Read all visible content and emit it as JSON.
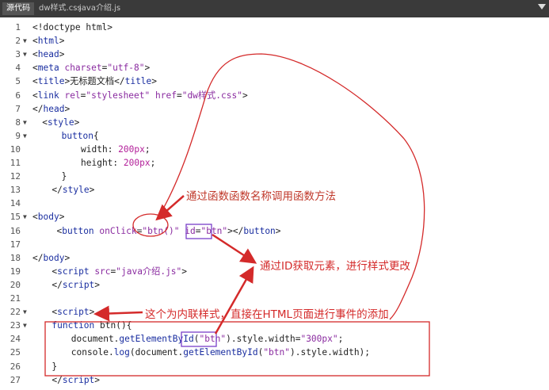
{
  "tabs": [
    {
      "label": "源代码",
      "active": true
    },
    {
      "label": "dw样式.css",
      "active": false
    },
    {
      "label": "java介绍.js",
      "active": false
    }
  ],
  "lines": [
    {
      "num": "1",
      "fold": "",
      "indent": 0,
      "tokens": [
        {
          "t": "p",
          "v": "<!doctype html>"
        }
      ]
    },
    {
      "num": "2",
      "fold": "▼",
      "indent": 0,
      "tokens": [
        {
          "t": "p",
          "v": "<"
        },
        {
          "t": "k",
          "v": "html"
        },
        {
          "t": "p",
          "v": ">"
        }
      ]
    },
    {
      "num": "3",
      "fold": "▼",
      "indent": 0,
      "tokens": [
        {
          "t": "p",
          "v": "<"
        },
        {
          "t": "k",
          "v": "head"
        },
        {
          "t": "p",
          "v": ">"
        }
      ]
    },
    {
      "num": "4",
      "fold": "",
      "indent": 0,
      "tokens": [
        {
          "t": "p",
          "v": "<"
        },
        {
          "t": "k",
          "v": "meta"
        },
        {
          "t": "p",
          "v": " "
        },
        {
          "t": "a",
          "v": "charset"
        },
        {
          "t": "p",
          "v": "="
        },
        {
          "t": "s",
          "v": "\"utf-8\""
        },
        {
          "t": "p",
          "v": ">"
        }
      ]
    },
    {
      "num": "5",
      "fold": "",
      "indent": 0,
      "tokens": [
        {
          "t": "p",
          "v": "<"
        },
        {
          "t": "k",
          "v": "title"
        },
        {
          "t": "p",
          "v": ">无标题文档</"
        },
        {
          "t": "k",
          "v": "title"
        },
        {
          "t": "p",
          "v": ">"
        }
      ]
    },
    {
      "num": "6",
      "fold": "",
      "indent": 0,
      "tokens": [
        {
          "t": "p",
          "v": "<"
        },
        {
          "t": "k",
          "v": "link"
        },
        {
          "t": "p",
          "v": " "
        },
        {
          "t": "a",
          "v": "rel"
        },
        {
          "t": "p",
          "v": "="
        },
        {
          "t": "s",
          "v": "\"stylesheet\""
        },
        {
          "t": "p",
          "v": " "
        },
        {
          "t": "a",
          "v": "href"
        },
        {
          "t": "p",
          "v": "="
        },
        {
          "t": "s",
          "v": "\"dw样式.css\""
        },
        {
          "t": "p",
          "v": ">"
        }
      ]
    },
    {
      "num": "7",
      "fold": "",
      "indent": 0,
      "tokens": [
        {
          "t": "p",
          "v": "</"
        },
        {
          "t": "k",
          "v": "head"
        },
        {
          "t": "p",
          "v": ">"
        }
      ]
    },
    {
      "num": "8",
      "fold": "▼",
      "indent": 2,
      "tokens": [
        {
          "t": "p",
          "v": "<"
        },
        {
          "t": "k",
          "v": "style"
        },
        {
          "t": "p",
          "v": ">"
        }
      ]
    },
    {
      "num": "9",
      "fold": "▼",
      "indent": 6,
      "tokens": [
        {
          "t": "k",
          "v": "button"
        },
        {
          "t": "p",
          "v": "{"
        }
      ]
    },
    {
      "num": "10",
      "fold": "",
      "indent": 10,
      "tokens": [
        {
          "t": "r",
          "v": "width"
        },
        {
          "t": "p",
          "v": ": "
        },
        {
          "t": "n",
          "v": "200px"
        },
        {
          "t": "p",
          "v": ";"
        }
      ]
    },
    {
      "num": "11",
      "fold": "",
      "indent": 10,
      "tokens": [
        {
          "t": "r",
          "v": "height"
        },
        {
          "t": "p",
          "v": ": "
        },
        {
          "t": "n",
          "v": "200px"
        },
        {
          "t": "p",
          "v": ";"
        }
      ]
    },
    {
      "num": "12",
      "fold": "",
      "indent": 6,
      "tokens": [
        {
          "t": "p",
          "v": "}"
        }
      ]
    },
    {
      "num": "13",
      "fold": "",
      "indent": 4,
      "tokens": [
        {
          "t": "p",
          "v": "</"
        },
        {
          "t": "k",
          "v": "style"
        },
        {
          "t": "p",
          "v": ">"
        }
      ]
    },
    {
      "num": "14",
      "fold": "",
      "indent": 0,
      "tokens": []
    },
    {
      "num": "15",
      "fold": "▼",
      "indent": 0,
      "tokens": [
        {
          "t": "p",
          "v": "<"
        },
        {
          "t": "k",
          "v": "body"
        },
        {
          "t": "p",
          "v": ">"
        }
      ]
    },
    {
      "num": "16",
      "fold": "",
      "indent": 5,
      "tokens": [
        {
          "t": "p",
          "v": "<"
        },
        {
          "t": "k",
          "v": "button"
        },
        {
          "t": "p",
          "v": " "
        },
        {
          "t": "a",
          "v": "onClick"
        },
        {
          "t": "p",
          "v": "="
        },
        {
          "t": "s",
          "v": "\"btn()\""
        },
        {
          "t": "p",
          "v": " "
        },
        {
          "t": "a",
          "v": "id"
        },
        {
          "t": "p",
          "v": "="
        },
        {
          "t": "s",
          "v": "\"btn\""
        },
        {
          "t": "p",
          "v": "></"
        },
        {
          "t": "k",
          "v": "button"
        },
        {
          "t": "p",
          "v": ">"
        }
      ]
    },
    {
      "num": "17",
      "fold": "",
      "indent": 0,
      "tokens": []
    },
    {
      "num": "18",
      "fold": "",
      "indent": 0,
      "tokens": [
        {
          "t": "p",
          "v": "</"
        },
        {
          "t": "k",
          "v": "body"
        },
        {
          "t": "p",
          "v": ">"
        }
      ]
    },
    {
      "num": "19",
      "fold": "",
      "indent": 4,
      "tokens": [
        {
          "t": "p",
          "v": "<"
        },
        {
          "t": "k",
          "v": "script"
        },
        {
          "t": "p",
          "v": " "
        },
        {
          "t": "a",
          "v": "src"
        },
        {
          "t": "p",
          "v": "="
        },
        {
          "t": "s",
          "v": "\"java介绍.js\""
        },
        {
          "t": "p",
          "v": ">"
        }
      ]
    },
    {
      "num": "20",
      "fold": "",
      "indent": 4,
      "tokens": [
        {
          "t": "p",
          "v": "</"
        },
        {
          "t": "k",
          "v": "script"
        },
        {
          "t": "p",
          "v": ">"
        }
      ]
    },
    {
      "num": "21",
      "fold": "",
      "indent": 0,
      "tokens": []
    },
    {
      "num": "22",
      "fold": "▼",
      "indent": 4,
      "tokens": [
        {
          "t": "p",
          "v": "<"
        },
        {
          "t": "k",
          "v": "script"
        },
        {
          "t": "p",
          "v": ">"
        }
      ]
    },
    {
      "num": "23",
      "fold": "▼",
      "indent": 4,
      "tokens": [
        {
          "t": "k",
          "v": "function"
        },
        {
          "t": "p",
          "v": " btn(){"
        }
      ]
    },
    {
      "num": "24",
      "fold": "",
      "indent": 8,
      "tokens": [
        {
          "t": "p",
          "v": "document."
        },
        {
          "t": "k",
          "v": "getElementById"
        },
        {
          "t": "p",
          "v": "("
        },
        {
          "t": "s",
          "v": "\"btn\""
        },
        {
          "t": "p",
          "v": ").style.width="
        },
        {
          "t": "s",
          "v": "\"300px\""
        },
        {
          "t": "p",
          "v": ";"
        }
      ]
    },
    {
      "num": "25",
      "fold": "",
      "indent": 8,
      "tokens": [
        {
          "t": "p",
          "v": "console."
        },
        {
          "t": "k",
          "v": "log"
        },
        {
          "t": "p",
          "v": "(document."
        },
        {
          "t": "k",
          "v": "getElementById"
        },
        {
          "t": "p",
          "v": "("
        },
        {
          "t": "s",
          "v": "\"btn\""
        },
        {
          "t": "p",
          "v": ").style.width);"
        }
      ]
    },
    {
      "num": "26",
      "fold": "",
      "indent": 4,
      "tokens": [
        {
          "t": "p",
          "v": "}"
        }
      ]
    },
    {
      "num": "27",
      "fold": "",
      "indent": 4,
      "tokens": [
        {
          "t": "p",
          "v": "</"
        },
        {
          "t": "k",
          "v": "script"
        },
        {
          "t": "p",
          "v": ">"
        }
      ]
    }
  ],
  "annotations": {
    "call_by_name": "通过函数函数名称调用函数方法",
    "get_by_id": "通过ID获取元素，进行样式更改",
    "inline_style": "这个为内联样式，直接在HTML页面进行事件的添加"
  },
  "colors": {
    "tabbar_bg": "#3a3a3a",
    "tag_keyword": "#1a2ea0",
    "attribute": "#8a2ba0",
    "number": "#b3209a",
    "annotation_red": "#d42a2a",
    "box_purple": "#7a3fc9"
  }
}
